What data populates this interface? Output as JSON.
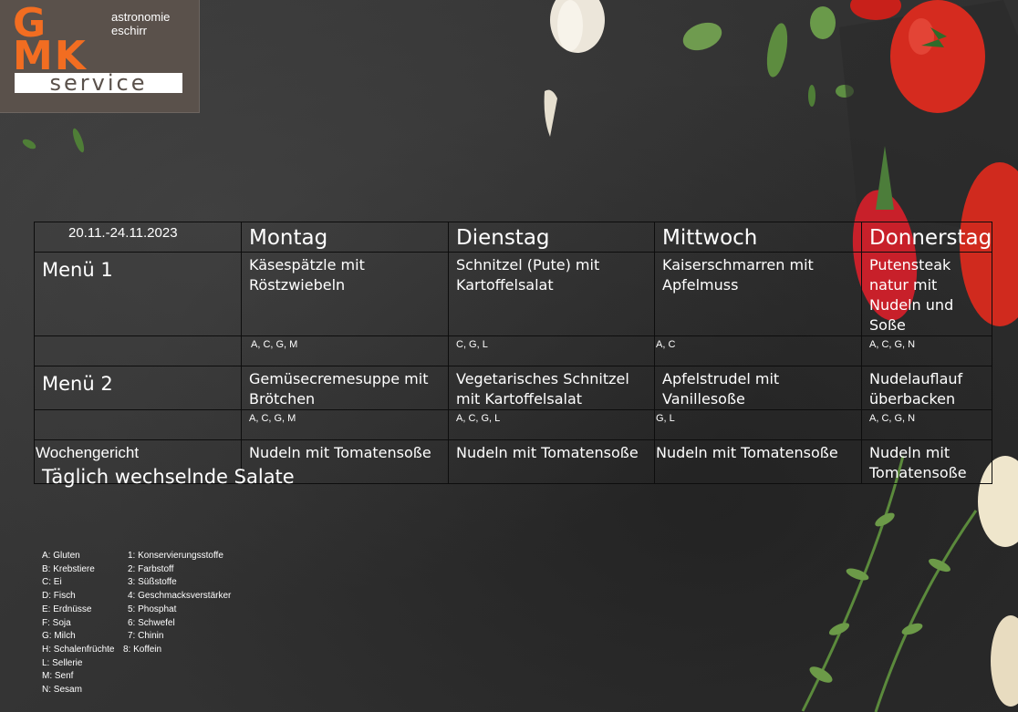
{
  "logo": {
    "letters_top": "G",
    "letters_middle": "MK",
    "service": "service",
    "line1": "astronomie",
    "line2": "eschirr"
  },
  "header": {
    "date_range": "20.11.-24.11.2023",
    "days": [
      "Montag",
      "Dienstag",
      "Mittwoch",
      "Donnerstag"
    ]
  },
  "menu1": {
    "label": "Menü 1",
    "dishes": [
      "Käsespätzle mit Röstzwiebeln",
      "Schnitzel (Pute) mit Kartoffelsalat",
      "Kaiserschmarren mit Apfelmuss",
      "Putensteak natur mit Nudeln und Soße"
    ],
    "allergens": [
      "A, C, G, M",
      "C, G, L",
      "A, C",
      "A, C, G, N"
    ]
  },
  "menu2": {
    "label": "Menü 2",
    "dishes": [
      "Gemüsecremesuppe mit Brötchen",
      "Vegetarisches Schnitzel mit Kartoffelsalat",
      "Apfelstrudel mit Vanillesoße",
      "Nudelauflauf überbacken"
    ],
    "allergens": [
      "A, C, G, M",
      "A, C, G, L",
      "G, L",
      "A, C, G, N"
    ]
  },
  "weekly": {
    "label": "Wochengericht",
    "dishes": [
      "Nudeln mit Tomatensoße",
      "Nudeln mit Tomatensoße",
      "Nudeln mit Tomatensoße",
      "Nudeln mit Tomatensoße"
    ]
  },
  "salads": "Täglich wechselnde Salate",
  "legend": {
    "allergens": [
      "A: Gluten",
      "B: Krebstiere",
      "C: Ei",
      "D: Fisch",
      "E: Erdnüsse",
      "F: Soja",
      "G: Milch",
      "H: Schalenfrüchte",
      "L: Sellerie",
      "M: Senf",
      "N: Sesam"
    ],
    "additives": [
      "1: Konservierungsstoffe",
      "2: Farbstoff",
      "3: Süßstoffe",
      "4: Geschmacksverstärker",
      "5: Phosphat",
      "6: Schwefel",
      "7: Chinin",
      "8: Koffein"
    ]
  },
  "colors": {
    "logo_orange": "#f26d21",
    "logo_bg": "#5a514b",
    "background": "#383838",
    "text": "#ffffff"
  }
}
